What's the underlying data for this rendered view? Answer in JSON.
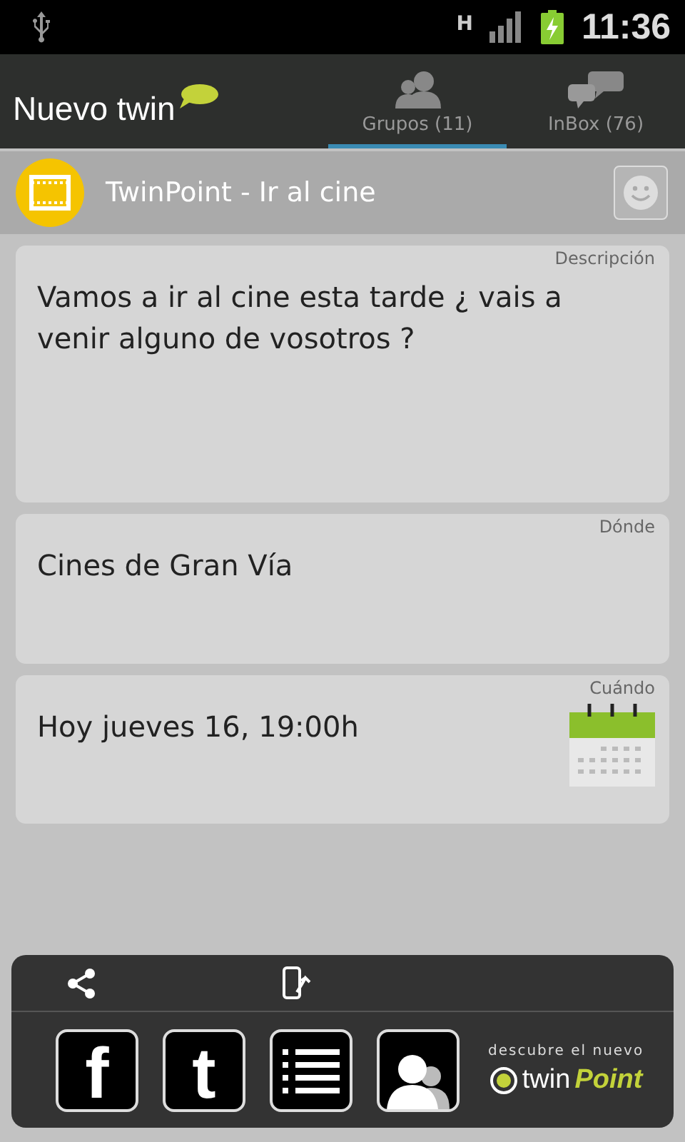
{
  "status_bar": {
    "network": "H",
    "time": "11:36"
  },
  "action_bar": {
    "logo": "Nuevo twin",
    "tabs": [
      {
        "label": "Grupos (11)",
        "kind": "groups",
        "selected": true
      },
      {
        "label": "InBox (76)",
        "kind": "inbox",
        "selected": false
      }
    ]
  },
  "header": {
    "title": "TwinPoint - Ir al cine"
  },
  "cards": [
    {
      "label": "Descripción",
      "value": "Vamos a ir al cine esta tarde ¿ vais a venir alguno de vosotros ?",
      "kind": "text"
    },
    {
      "label": "Dónde",
      "value": "Cines de Gran Vía",
      "kind": "text"
    },
    {
      "label": "Cuándo",
      "value": "Hoy jueves 16, 19:00h",
      "kind": "date"
    }
  ],
  "bottom_panel": {
    "buttons": [
      {
        "kind": "facebook",
        "glyph": "f"
      },
      {
        "kind": "twitter",
        "glyph": "t"
      },
      {
        "kind": "list"
      },
      {
        "kind": "contacts"
      }
    ],
    "promo": {
      "caption": "descubre el nuevo",
      "brand_prefix": "twin",
      "brand_suffix": "Point"
    }
  }
}
